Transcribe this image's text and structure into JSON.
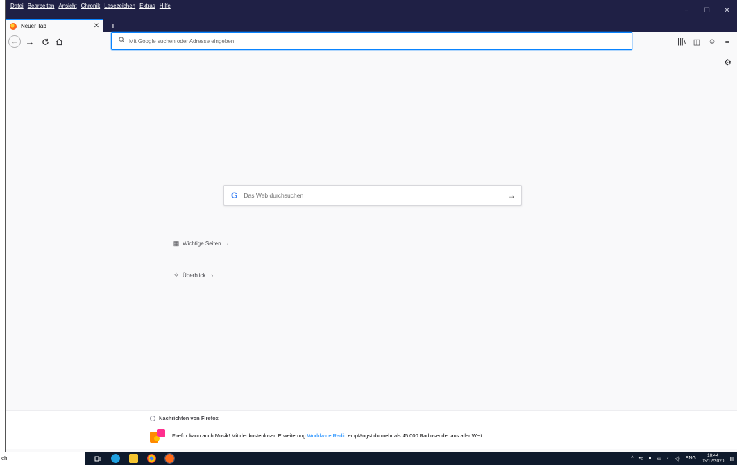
{
  "menu": [
    "Datei",
    "Bearbeiten",
    "Ansicht",
    "Chronik",
    "Lesezeichen",
    "Extras",
    "Hilfe"
  ],
  "window_controls": {
    "minimize": "−",
    "maximize": "☐",
    "close": "✕"
  },
  "tab": {
    "label": "Neuer Tab",
    "close": "✕",
    "new_tab": "+"
  },
  "nav": {
    "back": "←",
    "forward": "→",
    "reload": "C",
    "home": "⌂"
  },
  "urlbar": {
    "placeholder": "Mit Google suchen oder Adresse eingeben",
    "value": ""
  },
  "toolbar_right": {
    "library": "|||\\",
    "sidebar": "◫",
    "account": "☺",
    "menu": "≡"
  },
  "newtab": {
    "settings_icon": "⚙",
    "search": {
      "logo": "G",
      "placeholder": "Das Web durchsuchen",
      "go": "→"
    },
    "top_sites": {
      "icon": "▦",
      "label": "Wichtige Seiten",
      "chevron": "›"
    },
    "highlights": {
      "icon": "✧",
      "label": "Überblick",
      "chevron": "›"
    }
  },
  "snippet": {
    "heading": "Nachrichten von Firefox",
    "text_before": "Firefox kann auch Musik! Mit der kostenlosen Erweiterung ",
    "link": "Worldwide Radio",
    "text_after": " empfängst du mehr als 45.000 Radiosender aus aller Welt."
  },
  "taskbar": {
    "search_text": "ch",
    "tray": {
      "chevron": "^",
      "language": "ENG",
      "time": "10:44",
      "date": "03/12/2020"
    }
  },
  "colors": {
    "accent": "#0a84ff",
    "titlebar": "#1f2045",
    "taskbar": "#0f1a2c"
  }
}
